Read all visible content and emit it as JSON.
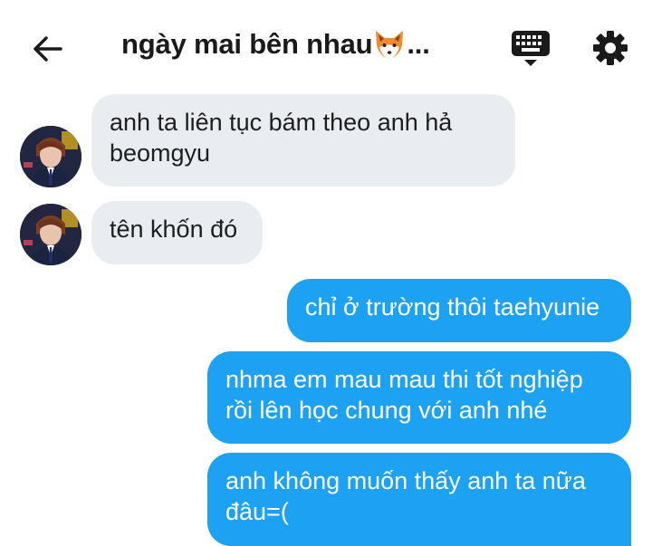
{
  "header": {
    "title": "ngày mai bên nhau",
    "title_suffix": "...",
    "back_icon": "arrow-left-icon",
    "keyboard_icon": "keyboard-icon",
    "settings_icon": "gear-icon"
  },
  "messages": [
    {
      "direction": "incoming",
      "text": "anh ta liên tục bám theo anh hả beomgyu"
    },
    {
      "direction": "incoming",
      "text": "tên khốn đó"
    },
    {
      "direction": "outgoing",
      "text": "chỉ ở trường thôi taehyunie"
    },
    {
      "direction": "outgoing",
      "text": "nhma em mau mau thi tốt nghiệp rồi lên học chung với anh nhé"
    },
    {
      "direction": "outgoing",
      "text": "anh không muốn thấy anh ta nữa đâu=("
    }
  ],
  "colors": {
    "incoming_bubble": "#e9edf1",
    "outgoing_bubble": "#1da1f2",
    "outgoing_text": "#ffffff"
  }
}
